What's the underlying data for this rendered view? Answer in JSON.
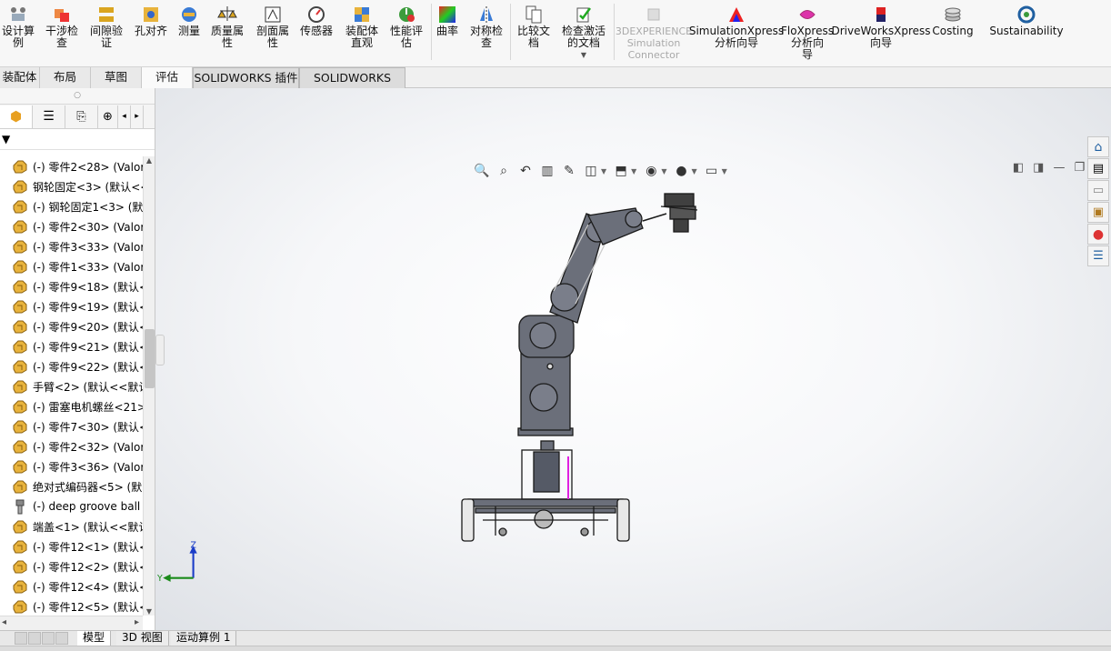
{
  "ribbon": {
    "buttons": [
      {
        "label": "设计算\n例",
        "icon": "design-study-icon"
      },
      {
        "label": "干涉检\n查",
        "icon": "interference-check-icon"
      },
      {
        "label": "间隙验\n证",
        "icon": "clearance-verification-icon"
      },
      {
        "label": "孔对齐",
        "icon": "hole-alignment-icon"
      },
      {
        "label": "测量",
        "icon": "measure-icon"
      },
      {
        "label": "质量属\n性",
        "icon": "mass-properties-icon"
      },
      {
        "label": "剖面属\n性",
        "icon": "section-properties-icon"
      },
      {
        "label": "传感器",
        "icon": "sensor-icon"
      },
      {
        "label": "装配体\n直观",
        "icon": "assembly-visualization-icon"
      },
      {
        "label": "性能评\n估",
        "icon": "performance-evaluation-icon"
      },
      {
        "label": "曲率",
        "icon": "curvature-icon"
      },
      {
        "label": "对称检\n查",
        "icon": "symmetry-check-icon"
      },
      {
        "label": "比较文\n档",
        "icon": "compare-documents-icon"
      },
      {
        "label": "检查激活\n的文档",
        "icon": "check-active-document-icon"
      },
      {
        "label": "3DEXPERIENCE\nSimulation\nConnector",
        "icon": "3dexperience-icon"
      },
      {
        "label": "SimulationXpress\n分析向导",
        "icon": "simulationxpress-icon"
      },
      {
        "label": "FloXpress\n分析向\n导",
        "icon": "floxpress-icon"
      },
      {
        "label": "DriveWorksXpress\n向导",
        "icon": "driveworksxpress-icon"
      },
      {
        "label": "Costing",
        "icon": "costing-icon"
      },
      {
        "label": "Sustainability",
        "icon": "sustainability-icon"
      }
    ]
  },
  "command_tabs": [
    "装配体",
    "布局",
    "草图",
    "评估",
    "SOLIDWORKS 插件",
    "SOLIDWORKS MBD"
  ],
  "feature_tree": {
    "items": [
      {
        "text": "(-) 零件2<28> (Valor",
        "icon": "part-icon"
      },
      {
        "text": "钢轮固定<3> (默认<<",
        "icon": "part-icon"
      },
      {
        "text": "(-) 钢轮固定1<3> (默",
        "icon": "part-icon"
      },
      {
        "text": "(-) 零件2<30> (Valor",
        "icon": "part-icon"
      },
      {
        "text": "(-) 零件3<33> (Valor",
        "icon": "part-icon"
      },
      {
        "text": "(-) 零件1<33> (Valor",
        "icon": "part-icon"
      },
      {
        "text": "(-) 零件9<18> (默认<",
        "icon": "part-icon"
      },
      {
        "text": "(-) 零件9<19> (默认<",
        "icon": "part-icon"
      },
      {
        "text": "(-) 零件9<20> (默认<",
        "icon": "part-icon"
      },
      {
        "text": "(-) 零件9<21> (默认<",
        "icon": "part-icon"
      },
      {
        "text": "(-) 零件9<22> (默认<",
        "icon": "part-icon"
      },
      {
        "text": "手臂<2> (默认<<默认",
        "icon": "part-icon"
      },
      {
        "text": "(-) 雷塞电机螺丝<21>",
        "icon": "part-icon"
      },
      {
        "text": "(-) 零件7<30> (默认<",
        "icon": "part-icon"
      },
      {
        "text": "(-) 零件2<32> (Valor",
        "icon": "part-icon"
      },
      {
        "text": "(-) 零件3<36> (Valor",
        "icon": "part-icon"
      },
      {
        "text": "绝对式编码器<5> (默",
        "icon": "part-icon"
      },
      {
        "text": "(-) deep groove ball",
        "icon": "toolbox-part-icon"
      },
      {
        "text": "端盖<1> (默认<<默认",
        "icon": "part-icon"
      },
      {
        "text": "(-) 零件12<1> (默认<",
        "icon": "part-icon"
      },
      {
        "text": "(-) 零件12<2> (默认<",
        "icon": "part-icon"
      },
      {
        "text": "(-) 零件12<4> (默认<",
        "icon": "part-icon"
      },
      {
        "text": "(-) 零件12<5> (默认<",
        "icon": "part-icon"
      }
    ]
  },
  "bottom_tabs": [
    "模型",
    "3D 视图",
    "运动算例 1"
  ],
  "triad": {
    "z": "Z",
    "y": "Y"
  },
  "colors": {
    "accent": "#1f6fbf",
    "part": "#e8b33c",
    "triad_z": "#1a3cc8",
    "triad_y": "#1a8a1a"
  }
}
